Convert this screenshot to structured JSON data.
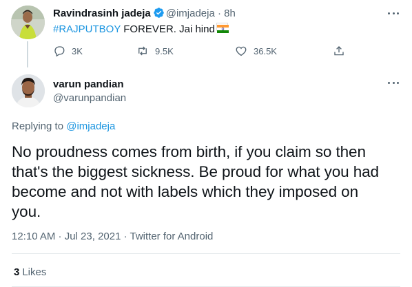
{
  "quoted_tweet": {
    "author_name": "Ravindrasinh jadeja",
    "handle": "@imjadeja",
    "separator": "·",
    "time_ago": "8h",
    "hashtag": "#RAJPUTBOY",
    "text": " FOREVER. Jai hind",
    "flag_icon": "india-flag-icon",
    "counts": {
      "replies": "3K",
      "retweets": "9.5K",
      "likes": "36.5K"
    }
  },
  "reply_tweet": {
    "author_name": "varun pandian",
    "handle": "@varunpandian",
    "replying_to_label": "Replying to",
    "replying_to_handle": "@imjadeja",
    "text": "No proudness comes from birth, if you claim so then that's the biggest sickness. Be proud for what you had become and not with labels which they imposed on you.",
    "timestamp": "12:10 AM · Jul 23, 2021 · Twitter for Android",
    "likes_count": "3",
    "likes_label": "Likes"
  },
  "colors": {
    "text_primary": "#0f1419",
    "text_secondary": "#536471",
    "link": "#1b95e0",
    "verified": "#1d9bf0",
    "divider": "#e4e9ec"
  }
}
